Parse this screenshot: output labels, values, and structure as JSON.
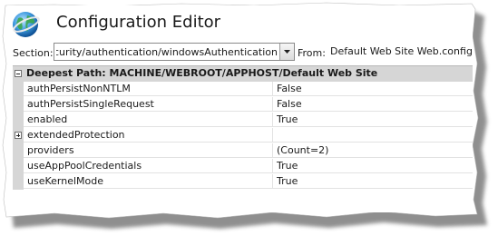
{
  "header": {
    "title": "Configuration Editor",
    "icon": "iis-globe-icon"
  },
  "section": {
    "label": "Section:",
    "value": "system.webServer/security/authentication/windowsAuthentication"
  },
  "from": {
    "label": "From:",
    "value": "Default Web Site Web.config"
  },
  "grid": {
    "category": {
      "title": "Deepest Path: MACHINE/WEBROOT/APPHOST/Default Web Site",
      "expanded": true
    },
    "rows": [
      {
        "name": "authPersistNonNTLM",
        "value": "False"
      },
      {
        "name": "authPersistSingleRequest",
        "value": "False"
      },
      {
        "name": "enabled",
        "value": "True"
      },
      {
        "name": "extendedProtection",
        "value": ""
      },
      {
        "name": "providers",
        "value": "(Count=2)"
      },
      {
        "name": "useAppPoolCredentials",
        "value": "True"
      },
      {
        "name": "useKernelMode",
        "value": "True"
      }
    ]
  },
  "colors": {
    "grid_gutter": "#d6d6d6",
    "grid_line": "#e2e2e2"
  }
}
